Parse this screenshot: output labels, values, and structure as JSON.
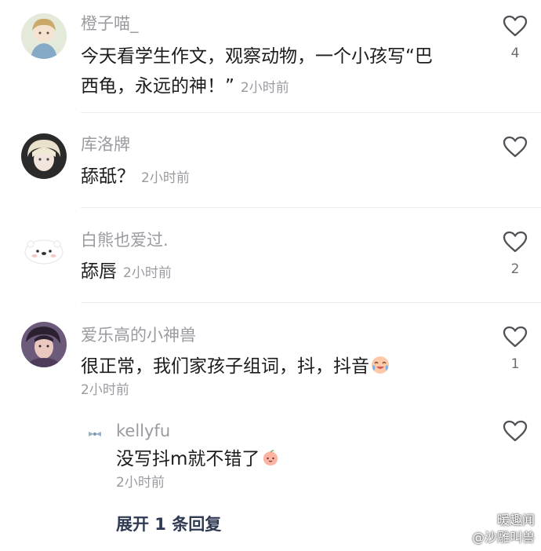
{
  "comments": [
    {
      "username": "橙子喵_",
      "text_line1": "今天看学生作文，观察动物，一个小孩写“巴",
      "text_line2": "西龟，永远的神！”",
      "time": "2小时前",
      "likes": "4"
    },
    {
      "username": "库洛牌",
      "text": "舔舐？",
      "time": "2小时前",
      "likes": ""
    },
    {
      "username": "白熊也爱过.",
      "text": "舔唇",
      "time": "2小时前",
      "likes": "2"
    },
    {
      "username": "爱乐高的小神兽",
      "text": "很正常，我们家孩子组词，抖，抖音",
      "emoji": "crying-laughing-emoji",
      "time": "2小时前",
      "likes": "1"
    }
  ],
  "reply": {
    "username": "kellyfu",
    "text": "没写抖m就不错了",
    "emoji": "peach-face-emoji",
    "time": "2小时前",
    "likes": ""
  },
  "expand_replies": "展开 1 条回复",
  "watermark": {
    "line1": "暖趣闻",
    "line2": "@沙雕叫兽"
  },
  "colors": {
    "username": "#9a9ba1",
    "content": "#1c1c1f",
    "expand": "#2f3a52"
  }
}
